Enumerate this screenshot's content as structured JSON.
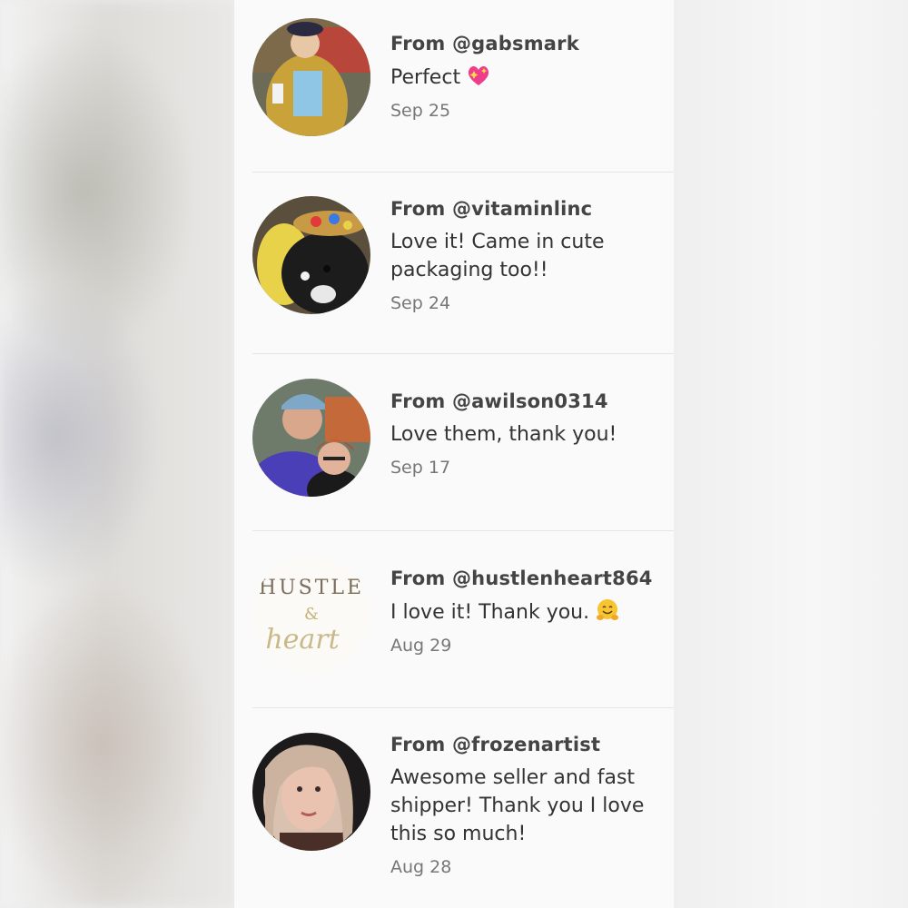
{
  "reviews": [
    {
      "handle": "From @gabsmark",
      "message": "Perfect",
      "emoji": "sparkling-heart-icon",
      "date": "Sep 25"
    },
    {
      "handle": "From @vitaminlinc",
      "message": "Love it! Came in cute packaging too!!",
      "date": "Sep 24"
    },
    {
      "handle": "From @awilson0314",
      "message": "Love them, thank you!",
      "date": "Sep 17"
    },
    {
      "handle": "From @hustlenheart864",
      "message": "I love it! Thank you.",
      "emoji": "hugging-face-icon",
      "date": "Aug 29",
      "avatar_text": {
        "line1": "HUSTLE",
        "line2": "&",
        "line3": "heart"
      }
    },
    {
      "handle": "From @frozenartist",
      "message": "Awesome seller and fast shipper! Thank you I love this so much!",
      "date": "Aug 28"
    }
  ]
}
